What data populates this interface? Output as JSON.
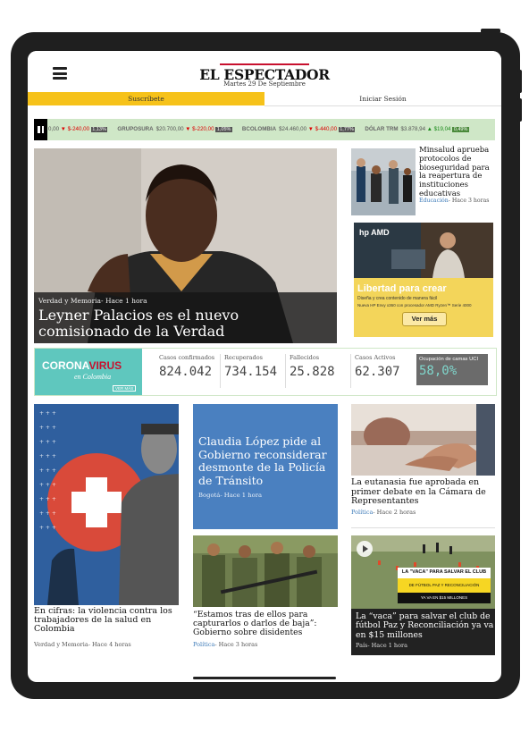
{
  "header": {
    "logo": "EL ESPECTADOR",
    "date": "Martes 29 De Septiembre",
    "subscribe": "Suscríbete",
    "login": "Iniciar Sesión"
  },
  "ticker": [
    {
      "name": "",
      "price": "0,00",
      "change": "▼ $-240,00",
      "pct": "1,13%",
      "dir": "down"
    },
    {
      "name": "GRUPOSURA",
      "price": "$20.700,00",
      "change": "▼ $-220,00",
      "pct": "1,05%",
      "dir": "down"
    },
    {
      "name": "BCOLOMBIA",
      "price": "$24.460,00",
      "change": "▼ $-440,00",
      "pct": "1,77%",
      "dir": "down"
    },
    {
      "name": "DÓLAR TRM",
      "price": "$3.878,94",
      "change": "▲ $19,04",
      "pct": "0,49%",
      "dir": "up"
    }
  ],
  "hero": {
    "section": "Verdad y Memoria",
    "time": "- Hace 1 hora",
    "title": "Leyner Palacios es el nuevo comisionado de la Verdad"
  },
  "side1": {
    "title": "Minsalud aprueba protocolos de bioseguridad para la reapertura de instituciones educativas",
    "section": "Educación",
    "time": "- Hace 3 horas"
  },
  "ad": {
    "brand": "hp AMD",
    "headline": "Libertad para crear",
    "line1": "Diseña y crea contenido de manera fácil",
    "line2": "Nueva HP Envy x360 con procesador AMD Ryzen™ Serie 4000",
    "button": "Ver más"
  },
  "covid": {
    "logo_a": "CORONA",
    "logo_b": "VIRUS",
    "subtitle": "en Colombia",
    "more": "VER MÁS",
    "stats": [
      {
        "label": "Casos confirmados",
        "value": "824.042"
      },
      {
        "label": "Recuperados",
        "value": "734.154"
      },
      {
        "label": "Fallecidos",
        "value": "25.828"
      },
      {
        "label": "Casos Activos",
        "value": "62.307"
      }
    ],
    "occupancy_label": "Ocupación de camas UCI",
    "occupancy_value": "58,0%"
  },
  "cards": {
    "a": {
      "title": "En cifras: la violencia contra los trabajadores de la salud en Colombia",
      "section": "Verdad y Memoria",
      "time": "- Hace 4 horas"
    },
    "b": {
      "title": "Claudia López pide al Gobierno reconsiderar desmonte de la Policía de Tránsito",
      "section": "Bogotá",
      "time": "- Hace 1 hora"
    },
    "c": {
      "title": "“Estamos tras de ellos para capturarlos o darlos de baja”: Gobierno sobre disidentes",
      "section": "Política",
      "time": "- Hace 3 horas"
    },
    "d": {
      "title": "La eutanasia fue aprobada en primer debate en la Cámara de Representantes",
      "section": "Política",
      "time": "- Hace 2 horas"
    },
    "e": {
      "title": "La “vaca” para salvar el club de fútbol Paz y Reconciliación ya va en $15 millones",
      "section": "País",
      "time": "- Hace 1 hora",
      "banner1": "LA \"VACA\" PARA SALVAR EL CLUB",
      "banner2": "DE FÚTBOL PAZ Y RECONCILIACIÓN",
      "banner3": "YA VA EN $15 MILLONES"
    }
  },
  "colors": {
    "accent": "#f6c21a",
    "brand_red": "#c8102e",
    "link": "#3c7ab8",
    "covid": "#5fc7be"
  }
}
